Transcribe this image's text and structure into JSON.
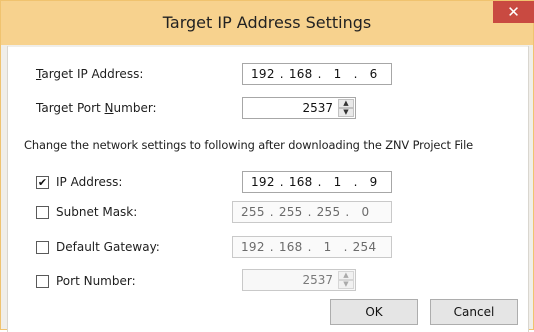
{
  "window": {
    "title": "Target IP Address Settings",
    "close_glyph": "✕"
  },
  "target_ip": {
    "label_u": "T",
    "label_rest": "arget IP Address:",
    "octets": [
      "192",
      "168",
      "1",
      "6"
    ]
  },
  "target_port": {
    "label_pre": "Target Port ",
    "label_u": "N",
    "label_rest": "umber:",
    "value": "2537"
  },
  "section_note": "Change the network settings to following after downloading the ZNV Project File",
  "ip_address": {
    "label": "IP Address:",
    "checked": true,
    "check_glyph": "✔",
    "octets": [
      "192",
      "168",
      "1",
      "9"
    ]
  },
  "subnet_mask": {
    "label": "Subnet Mask:",
    "checked": false,
    "octets": [
      "255",
      "255",
      "255",
      "0"
    ]
  },
  "default_gateway": {
    "label": "Default Gateway:",
    "checked": false,
    "octets": [
      "192",
      "168",
      "1",
      "254"
    ]
  },
  "port_number": {
    "label": "Port Number:",
    "checked": false,
    "value": "2537"
  },
  "spin_glyphs": {
    "up": "▲",
    "down": "▼"
  },
  "buttons": {
    "ok": "OK",
    "cancel": "Cancel"
  },
  "colors": {
    "title_bar": "#f7d28e",
    "close_button": "#c94a41",
    "frame": "#f0eee9"
  }
}
